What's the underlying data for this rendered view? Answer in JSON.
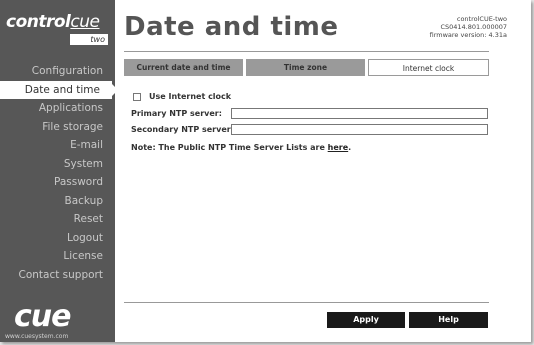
{
  "brand": {
    "logo_main": "control",
    "logo_accent": "cue",
    "logo_sub": "two",
    "bottom_logo": "cue",
    "url": "www.cuesystem.com"
  },
  "nav": {
    "items": [
      {
        "label": "Configuration"
      },
      {
        "label": "Date and time",
        "active": true
      },
      {
        "label": "Applications"
      },
      {
        "label": "File storage"
      },
      {
        "label": "E-mail"
      },
      {
        "label": "System"
      },
      {
        "label": "Password"
      },
      {
        "label": "Backup"
      },
      {
        "label": "Reset"
      },
      {
        "label": "Logout"
      },
      {
        "label": "License"
      },
      {
        "label": "Contact support"
      }
    ]
  },
  "header": {
    "title": "Date and time",
    "device_name": "controlCUE-two",
    "device_id": "CS0414.801.000007",
    "firmware": "firmware version: 4.31a"
  },
  "tabs": [
    {
      "label": "Current date and time"
    },
    {
      "label": "Time zone"
    },
    {
      "label": "Internet clock",
      "active": true
    }
  ],
  "form": {
    "use_internet_clock_label": "Use Internet clock",
    "use_internet_clock_checked": false,
    "primary_label": "Primary NTP server:",
    "primary_value": "",
    "secondary_label": "Secondary NTP server:",
    "secondary_value": "",
    "note_prefix": "Note: The Public NTP Time Server Lists are ",
    "note_link": "here",
    "note_suffix": "."
  },
  "footer": {
    "apply_label": "Apply",
    "help_label": "Help"
  }
}
